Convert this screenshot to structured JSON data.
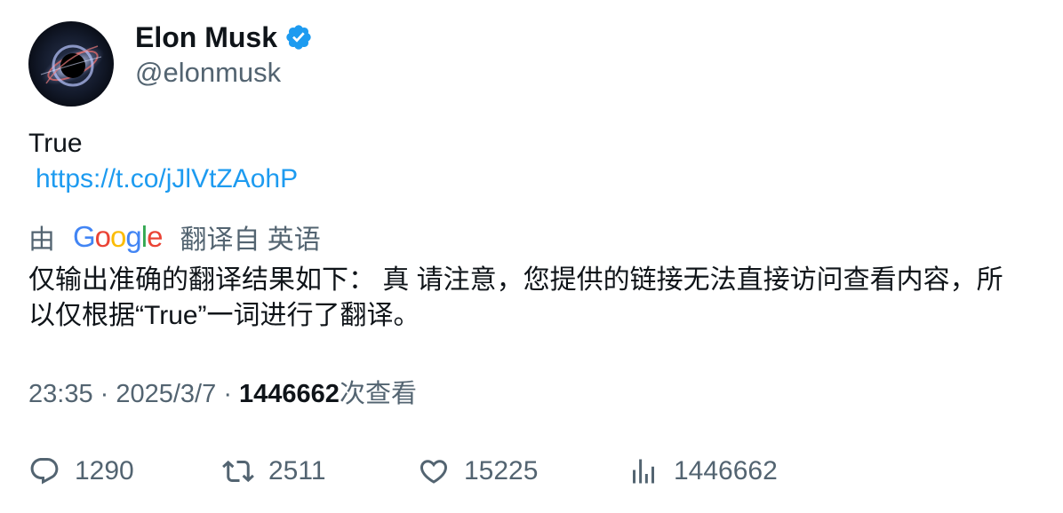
{
  "author": {
    "display_name": "Elon Musk",
    "handle": "@elonmusk",
    "verified": true,
    "avatar_icon": "black-hole-avatar"
  },
  "tweet": {
    "text": "True",
    "link": "https://t.co/jJlVtZAohP"
  },
  "translation": {
    "prefix": "由",
    "provider": "Google",
    "suffix": "翻译自 英语",
    "text": "仅输出准确的翻译结果如下： 真 请注意，您提供的链接无法直接访问查看内容，所以仅根据“True”一词进行了翻译。"
  },
  "meta": {
    "time": "23:35",
    "separator": "·",
    "date": "2025/3/7",
    "views_count": "1446662",
    "views_label": "次查看"
  },
  "actions": {
    "reply": {
      "icon": "reply-icon",
      "count": "1290"
    },
    "retweet": {
      "icon": "retweet-icon",
      "count": "2511"
    },
    "like": {
      "icon": "heart-icon",
      "count": "15225"
    },
    "views": {
      "icon": "bar-chart-icon",
      "count": "1446662"
    }
  },
  "colors": {
    "primary_text": "#0f1419",
    "secondary_text": "#536471",
    "link": "#1d9bf0",
    "verified": "#1d9bf0"
  }
}
